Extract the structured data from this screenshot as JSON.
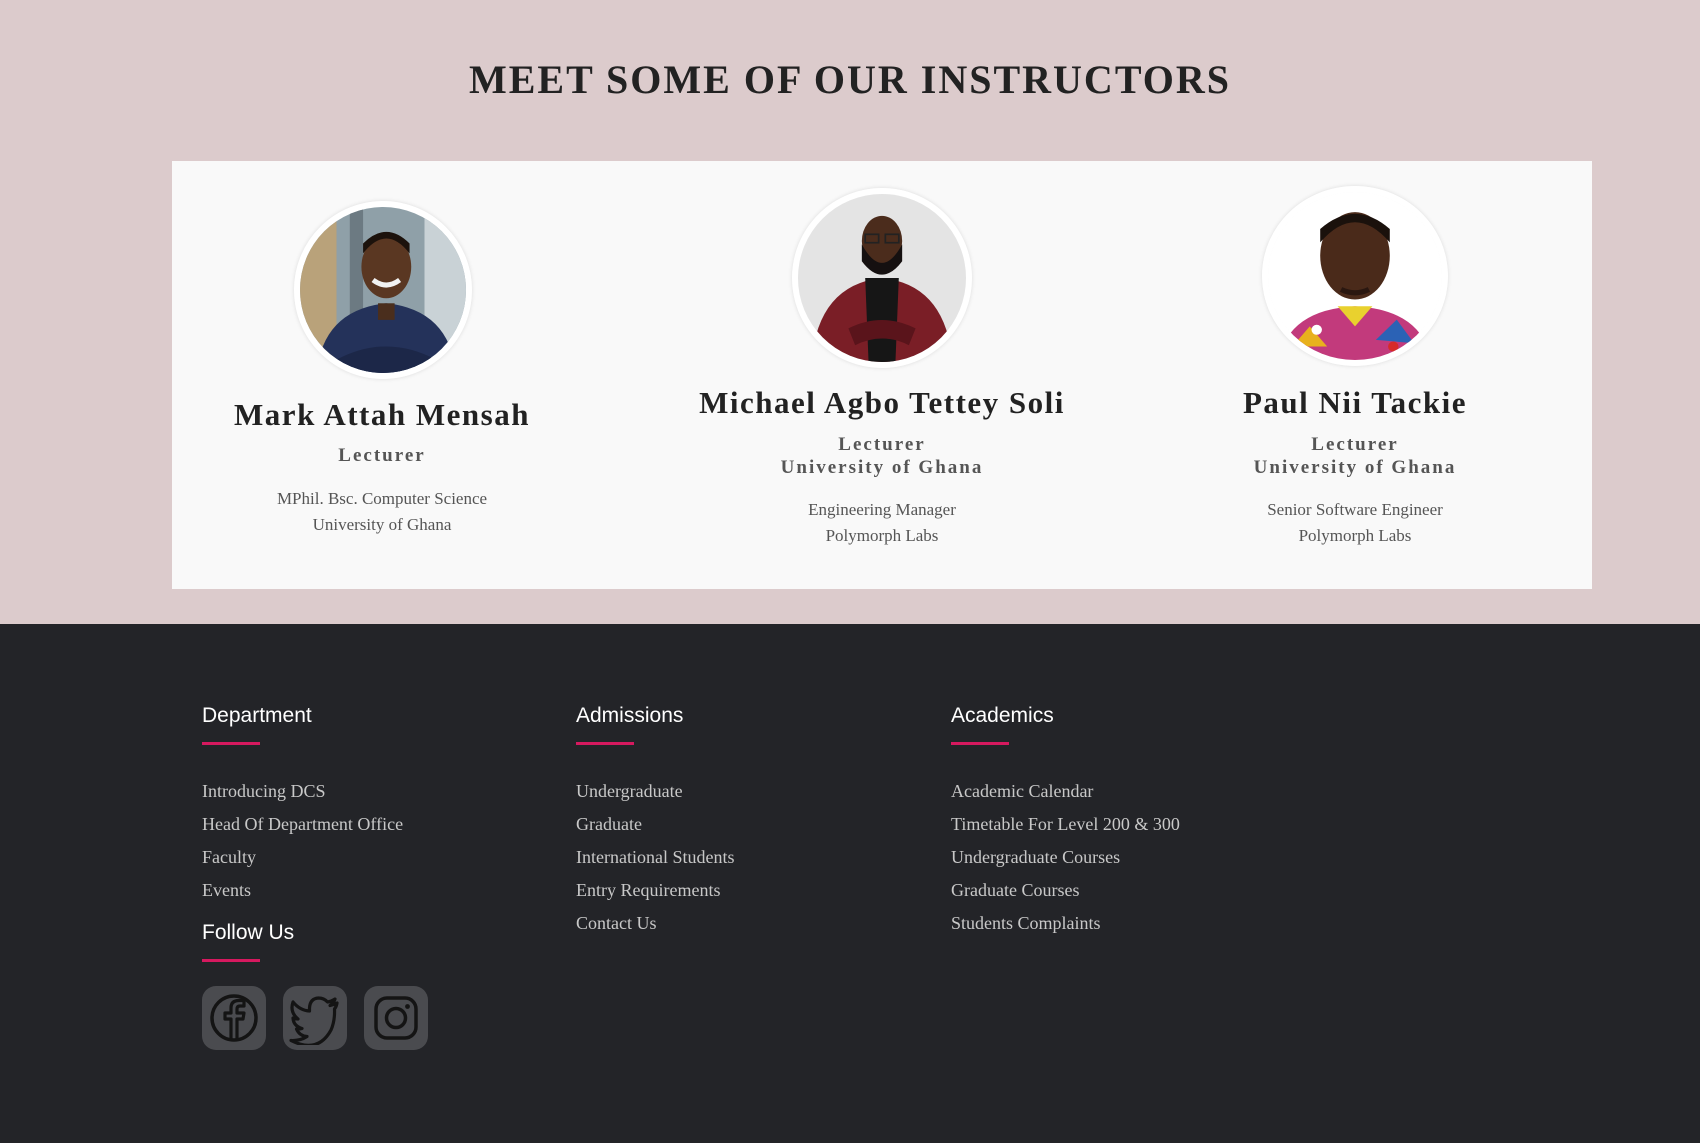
{
  "section": {
    "heading": "MEET SOME OF OUR INSTRUCTORS"
  },
  "instructors": [
    {
      "name": "Mark Attah Mensah",
      "role": "Lecturer",
      "affiliation": "",
      "desc_line1": "MPhil. Bsc. Computer Science",
      "desc_line2": "University of Ghana"
    },
    {
      "name": "Michael Agbo Tettey Soli",
      "role": "Lecturer",
      "affiliation": "University of Ghana",
      "desc_line1": "Engineering Manager",
      "desc_line2": "Polymorph Labs"
    },
    {
      "name": "Paul Nii Tackie",
      "role": "Lecturer",
      "affiliation": "University of Ghana",
      "desc_line1": "Senior Software Engineer",
      "desc_line2": "Polymorph Labs"
    }
  ],
  "footer": {
    "department": {
      "title": "Department",
      "links": [
        "Introducing DCS",
        "Head Of Department Office",
        "Faculty",
        "Events"
      ]
    },
    "admissions": {
      "title": "Admissions",
      "links": [
        "Undergraduate",
        "Graduate",
        "International Students",
        "Entry Requirements",
        "Contact Us"
      ]
    },
    "academics": {
      "title": "Academics",
      "links": [
        "Academic Calendar",
        "Timetable For Level 200 & 300",
        "Undergraduate Courses",
        "Graduate Courses",
        "Students Complaints"
      ]
    },
    "follow": {
      "title": "Follow Us",
      "icons": [
        "facebook-icon",
        "twitter-icon",
        "instagram-icon"
      ]
    }
  },
  "colors": {
    "top_background": "#dccbcc",
    "card_background": "#f9f9f9",
    "footer_background": "#232428",
    "accent": "#d6195f"
  }
}
